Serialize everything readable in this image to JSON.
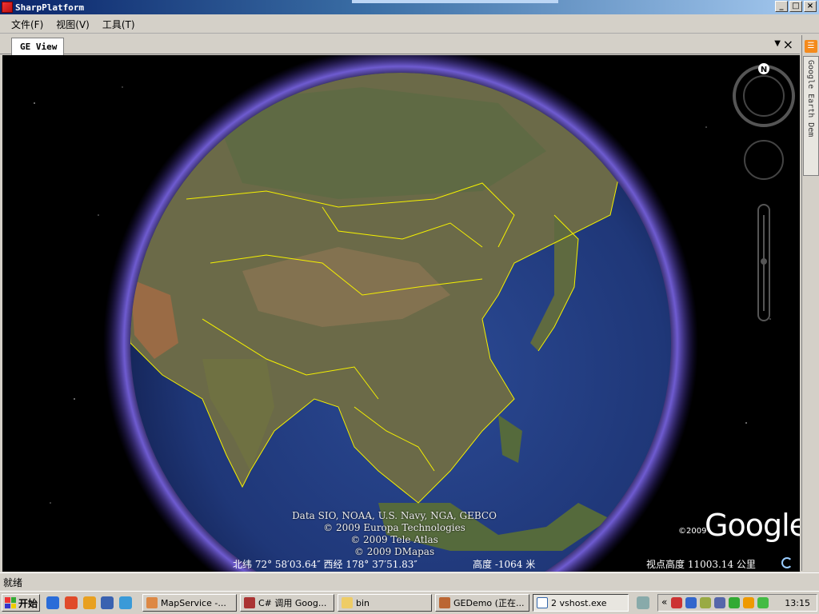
{
  "window": {
    "title": "SharpPlatform",
    "buttons": {
      "minimize": "_",
      "maximize": "□",
      "close": "×"
    }
  },
  "menu": [
    {
      "label": "文件(F)"
    },
    {
      "label": "视图(V)"
    },
    {
      "label": "工具(T)"
    }
  ],
  "document_tab": {
    "label": "GE View",
    "dropdown": "▼",
    "close": "×"
  },
  "side_panel": {
    "tab_label": "Google Earth Dem",
    "rss": "☰"
  },
  "map": {
    "compass_label": "N",
    "attributions": [
      "Data SIO, NOAA, U.S. Navy, NGA, GEBCO",
      "© 2009 Europa Technologies",
      "© 2009 Tele Atlas",
      "© 2009 DMapas"
    ],
    "logo_year": "©2009",
    "logo": "Google",
    "coordinates": "北纬 72° 58′03.64″  西经 178° 37′51.83″",
    "elevation": "高度 -1064 米",
    "eye_altitude": "视点高度 11003.14 公里",
    "colors": {
      "ocean": "#25418a",
      "land": "#6b6a48",
      "atmosphere": "#7b66e8",
      "borders": "#f4f000"
    }
  },
  "status_bar": {
    "text": "就绪"
  },
  "taskbar": {
    "start_label": "开始",
    "tasks": [
      {
        "label": "MapService -..."
      },
      {
        "label": "C# 调用 Goog..."
      },
      {
        "label": "bin"
      },
      {
        "label": "GEDemo (正在..."
      },
      {
        "label": "2 vshost.exe"
      }
    ],
    "tray_arrow": "«",
    "clock": "13:15"
  }
}
